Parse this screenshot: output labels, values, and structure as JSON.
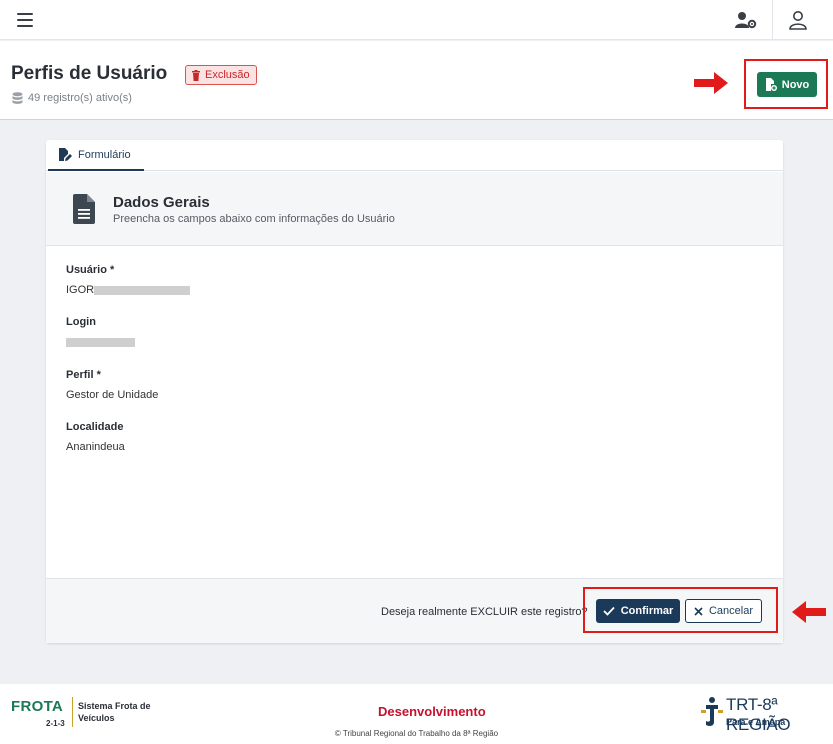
{
  "topbar": {
    "menu_icon": "hamburger-icon",
    "user_settings_icon": "user-cog-icon",
    "profile_icon": "user-icon"
  },
  "header": {
    "title": "Perfis de Usuário",
    "badge_label": "Exclusão",
    "badge_icon": "trash-icon",
    "record_count": "49 registro(s) ativo(s)",
    "record_icon": "database-icon",
    "new_button_label": "Novo",
    "new_button_icon": "file-plus-icon"
  },
  "tabs": [
    {
      "label": "Formulário",
      "icon": "edit-file-icon",
      "active": true
    }
  ],
  "section": {
    "title": "Dados Gerais",
    "subtitle": "Preencha os campos abaixo com informações do Usuário",
    "icon": "document-icon"
  },
  "fields": [
    {
      "label": "Usuário *",
      "value": "IGOR"
    },
    {
      "label": "Login",
      "value": ""
    },
    {
      "label": "Perfil *",
      "value": "Gestor de Unidade"
    },
    {
      "label": "Localidade",
      "value": "Ananindeua"
    }
  ],
  "actions": {
    "question": "Deseja realmente EXCLUIR este registro?",
    "confirm_label": "Confirmar",
    "cancel_label": "Cancelar"
  },
  "footer": {
    "app_name": "FROTA",
    "app_version": "2-1-3",
    "app_description": "Sistema Frota de Veículos",
    "environment": "Desenvolvimento",
    "copyright": "© Tribunal Regional do Trabalho da 8ª Região",
    "org_name": "TRT-8ª REGIÃO",
    "org_sub": "Pará e Amapá"
  },
  "colors": {
    "primary": "#1b3a5a",
    "success": "#1b7a55",
    "danger": "#c62828",
    "annotation": "#e11a1a"
  }
}
